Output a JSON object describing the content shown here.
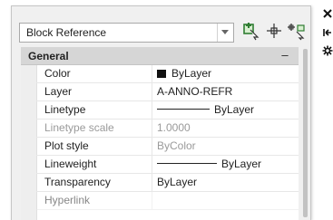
{
  "toolbar": {
    "object_type": "Block Reference",
    "icons": [
      "quick-select-icon",
      "pickadd-icon",
      "select-objects-icon"
    ]
  },
  "side_strip": {
    "icons": [
      "close-icon",
      "auto-hide-icon",
      "properties-menu-icon"
    ]
  },
  "section": {
    "title": "General",
    "collapse_symbol": "–"
  },
  "properties": [
    {
      "name": "Color",
      "value": "ByLayer",
      "kind": "color",
      "swatch_color": "#111111"
    },
    {
      "name": "Layer",
      "value": "A-ANNO-REFR",
      "kind": "text"
    },
    {
      "name": "Linetype",
      "value": "ByLayer",
      "kind": "line"
    },
    {
      "name": "Linetype scale",
      "value": "1.0000",
      "kind": "text",
      "disabled": true
    },
    {
      "name": "Plot style",
      "value": "ByColor",
      "kind": "text",
      "disabled": true
    },
    {
      "name": "Lineweight",
      "value": "ByLayer",
      "kind": "line"
    },
    {
      "name": "Transparency",
      "value": "ByLayer",
      "kind": "text"
    },
    {
      "name": "Hyperlink",
      "value": "",
      "kind": "text"
    }
  ],
  "colors": {
    "section_header": "#d6d6d6",
    "panel_bg": "#f0f0f0",
    "disabled_text": "#9a9a9a"
  }
}
